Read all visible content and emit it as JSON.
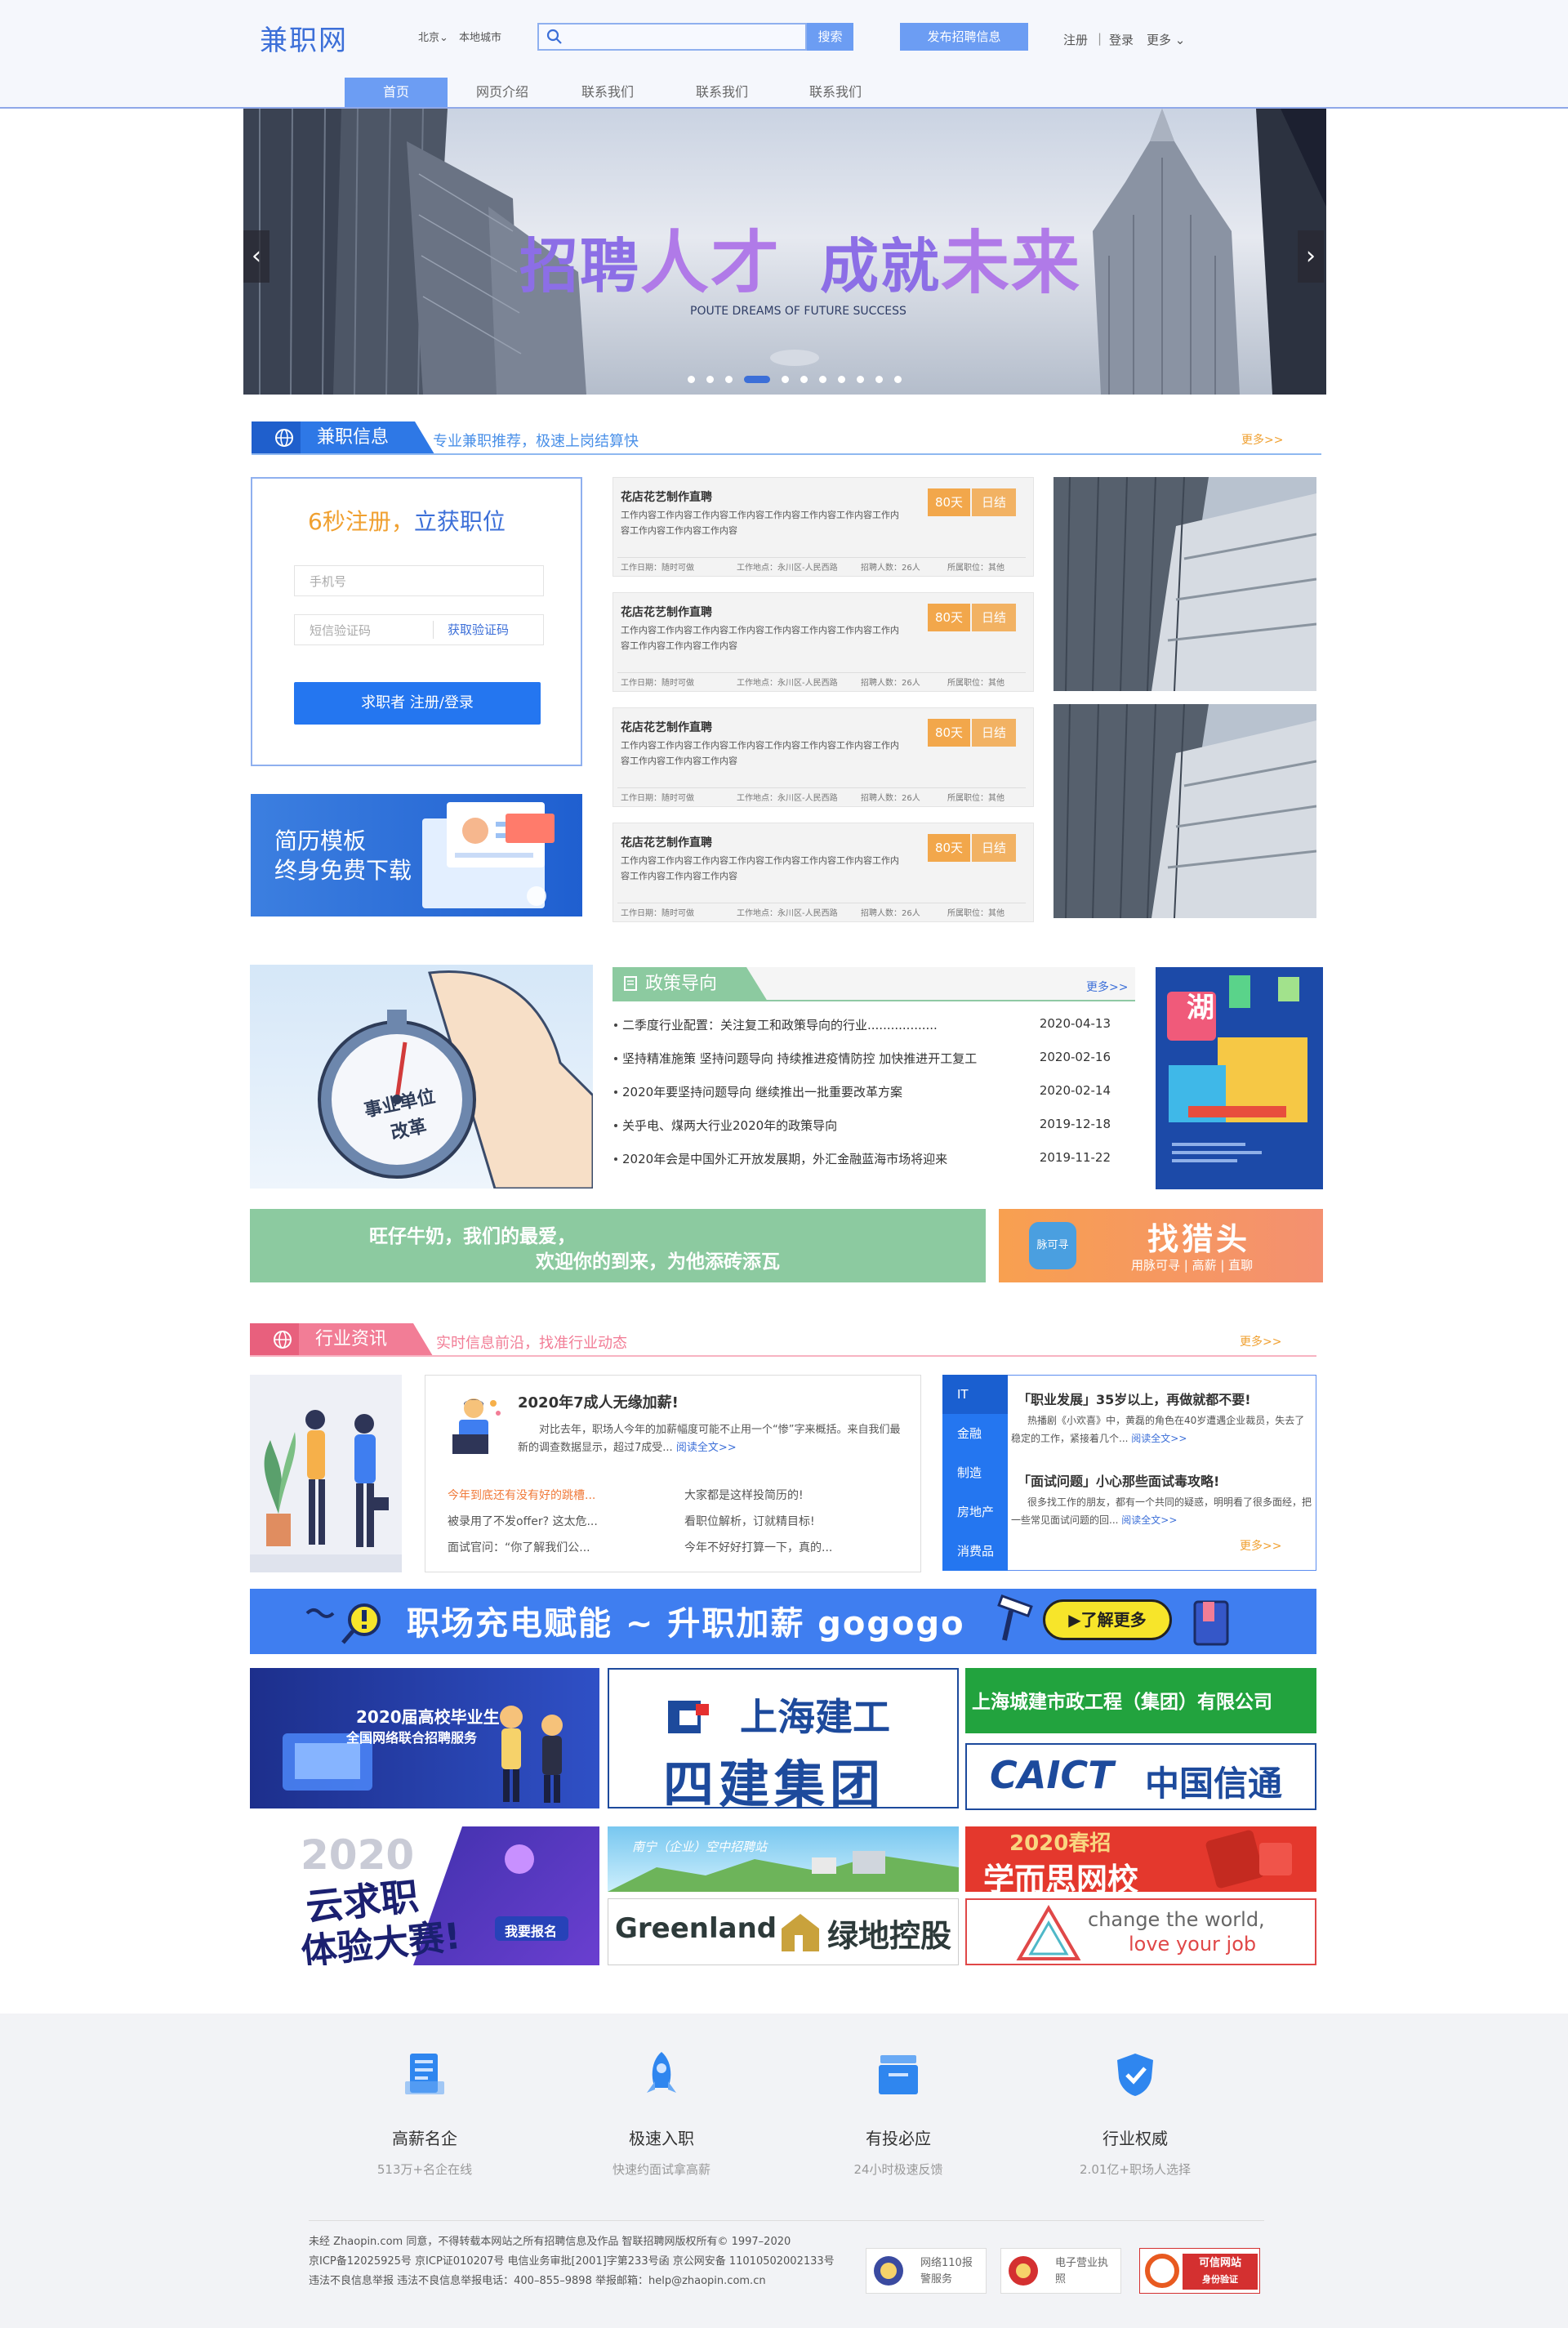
{
  "header": {
    "logo": "兼职网",
    "city": "北京",
    "city_chevron": "⌄",
    "local_city": "本地城市",
    "search_button": "搜索",
    "post_button": "发布招聘信息",
    "register": "注册",
    "separator": "|",
    "login": "登录",
    "more": "更多",
    "more_chevron": "⌄"
  },
  "nav": [
    "首页",
    "网页介绍",
    "联系我们",
    "联系我们",
    "联系我们"
  ],
  "banner": {
    "title_a": "招聘",
    "title_b": "人才",
    "title_c": "成就",
    "title_d": "未来",
    "subtitle": "POUTE DREAMS OF FUTURE SUCCESS",
    "prev": "‹",
    "next": "›",
    "slide_count": 11,
    "active_slide": 3
  },
  "parttime": {
    "tab": "兼职信息",
    "subtitle": "专业兼职推荐，极速上岗结算快",
    "more": "更多>>",
    "register_card": {
      "title_prefix": "6秒注册，",
      "title_suffix": "立获职位",
      "phone_placeholder": "手机号",
      "sms_placeholder": "短信验证码",
      "get_code": "获取验证码",
      "button": "求职者  注册/登录"
    },
    "resume": {
      "line1": "简历模板",
      "line2": "终身免费下载"
    },
    "jobs": [
      {
        "title": "花店花艺制作直聘",
        "desc": "工作内容工作内容工作内容工作内容工作内容工作内容工作内容工作内容工作内容工作内容工作内容",
        "days": "80天",
        "pay": "日结",
        "time": "工作日期：随时可做",
        "place": "工作地点：永川区-人民西路",
        "count": "招聘人数：26人",
        "category": "所属职位：其他"
      },
      {
        "title": "花店花艺制作直聘",
        "desc": "工作内容工作内容工作内容工作内容工作内容工作内容工作内容工作内容工作内容工作内容工作内容",
        "days": "80天",
        "pay": "日结",
        "time": "工作日期：随时可做",
        "place": "工作地点：永川区-人民西路",
        "count": "招聘人数：26人",
        "category": "所属职位：其他"
      },
      {
        "title": "花店花艺制作直聘",
        "desc": "工作内容工作内容工作内容工作内容工作内容工作内容工作内容工作内容工作内容工作内容工作内容",
        "days": "80天",
        "pay": "日结",
        "time": "工作日期：随时可做",
        "place": "工作地点：永川区-人民西路",
        "count": "招聘人数：26人",
        "category": "所属职位：其他"
      },
      {
        "title": "花店花艺制作直聘",
        "desc": "工作内容工作内容工作内容工作内容工作内容工作内容工作内容工作内容工作内容工作内容工作内容",
        "days": "80天",
        "pay": "日结",
        "time": "工作日期：随时可做",
        "place": "工作地点：永川区-人民西路",
        "count": "招聘人数：26人",
        "category": "所属职位：其他"
      }
    ]
  },
  "policy": {
    "image_text_1": "事业单位",
    "image_text_2": "改革",
    "tab": "政策导向",
    "more": "更多>>",
    "items": [
      {
        "text": "二季度行业配置：关注复工和政策导向的行业..................",
        "date": "2020-04-13"
      },
      {
        "text": "坚持精准施策 坚持问题导向 持续推进疫情防控 加快推进开工复工",
        "date": "2020-02-16"
      },
      {
        "text": "2020年要坚持问题导向 继续推出一批重要改革方案",
        "date": "2020-02-14"
      },
      {
        "text": "关乎电、煤两大行业2020年的政策导向",
        "date": "2019-12-18"
      },
      {
        "text": "2020年会是中国外汇开放发展期，外汇金融蓝海市场将迎来",
        "date": "2019-11-22"
      }
    ],
    "poster_title": "湖"
  },
  "ads": {
    "green_line1": "旺仔牛奶，我们的最爱，",
    "green_line2": "欢迎你的到来，为他添砖添瓦",
    "hunter_icon": "脉可寻",
    "hunter_title": "找猎头",
    "hunter_sub": "用脉可寻 | 高薪 | 直聊"
  },
  "industry": {
    "tab": "行业资讯",
    "subtitle": "实时信息前沿，找准行业动态",
    "more": "更多>>",
    "headline": "2020年7成人无缘加薪!",
    "summary": "对比去年，职场人今年的加薪幅度可能不止用一个“惨”字来概括。来自我们最新的调查数据显示，超过7成受...",
    "read_more": "阅读全文>>",
    "links": [
      {
        "text": "今年到底还有没有好的跳槽...",
        "hot": true
      },
      {
        "text": "大家都是这样投简历的!",
        "hot": false
      },
      {
        "text": "被录用了不发offer? 这太危...",
        "hot": false
      },
      {
        "text": "看职位解析，订就精目标!",
        "hot": false
      },
      {
        "text": "面试官问：“你了解我们公...",
        "hot": false
      },
      {
        "text": "今年不好好打算一下，真的...",
        "hot": false
      }
    ],
    "categories": [
      "IT",
      "金融",
      "制造",
      "房地产",
      "消费品"
    ],
    "articles": [
      {
        "title": "「职业发展」35岁以上，再做就都不要!",
        "body": "热播剧《小欢喜》中，黄磊的角色在40岁遭遇企业裁员，失去了稳定的工作，紧接着几个...",
        "read": "阅读全文>>"
      },
      {
        "title": "「面试问题」小心那些面试毒攻略!",
        "body": "很多找工作的朋友，都有一个共同的疑惑，明明看了很多面经，把一些常见面试问题的回...",
        "read": "阅读全文>>"
      }
    ],
    "right_more": "更多>>"
  },
  "promo": {
    "text": "职场充电赋能  ~  升职加薪 gogogo",
    "button": "▶了解更多"
  },
  "logos": {
    "graduate": "2020届高校毕业生",
    "graduate_sub": "全国网络联合招聘服务",
    "shanghai_top": "上海建工",
    "shanghai_bottom": "四建集团",
    "municipal": "上海城建市政工程（集团）有限公司",
    "caict_en": "CAICT",
    "caict_cn": "中国信通院",
    "cloud_year": "2020",
    "cloud_title1": "云求职",
    "cloud_title2": "体验大赛!",
    "cloud_btn": "我要报名",
    "nanning": "南宁（企业）空中招聘站",
    "xueersi_top": "2020春招",
    "xueersi": "学而思网校",
    "greenland_en": "Greenland",
    "greenland_cn": "绿地控股",
    "change1": "change the world,",
    "change2": "love your job"
  },
  "footer": {
    "features": [
      {
        "title": "高薪名企",
        "sub": "513万+名企在线",
        "icon": "document-icon"
      },
      {
        "title": "极速入职",
        "sub": "快速约面试拿高薪",
        "icon": "rocket-icon"
      },
      {
        "title": "有投必应",
        "sub": "24小时极速反馈",
        "icon": "inbox-icon"
      },
      {
        "title": "行业权威",
        "sub": "2.01亿+职场人选择",
        "icon": "shield-check-icon"
      }
    ],
    "copyright_1": "未经 Zhaopin.com 同意，不得转载本网站之所有招聘信息及作品 智联招聘网版权所有© 1997–2020",
    "copyright_2": "京ICP备12025925号 京ICP证010207号 电信业务审批[2001]字第233号函 京公网安备 11010502002133号",
    "copyright_3": "违法不良信息举报 违法不良信息举报电话：400–855–9898 举报邮箱：help@zhaopin.com.cn",
    "badge1": "网络110报警服务",
    "badge2": "电子营业执照",
    "badge3_a": "可信网站",
    "badge3_b": "身份验证"
  }
}
